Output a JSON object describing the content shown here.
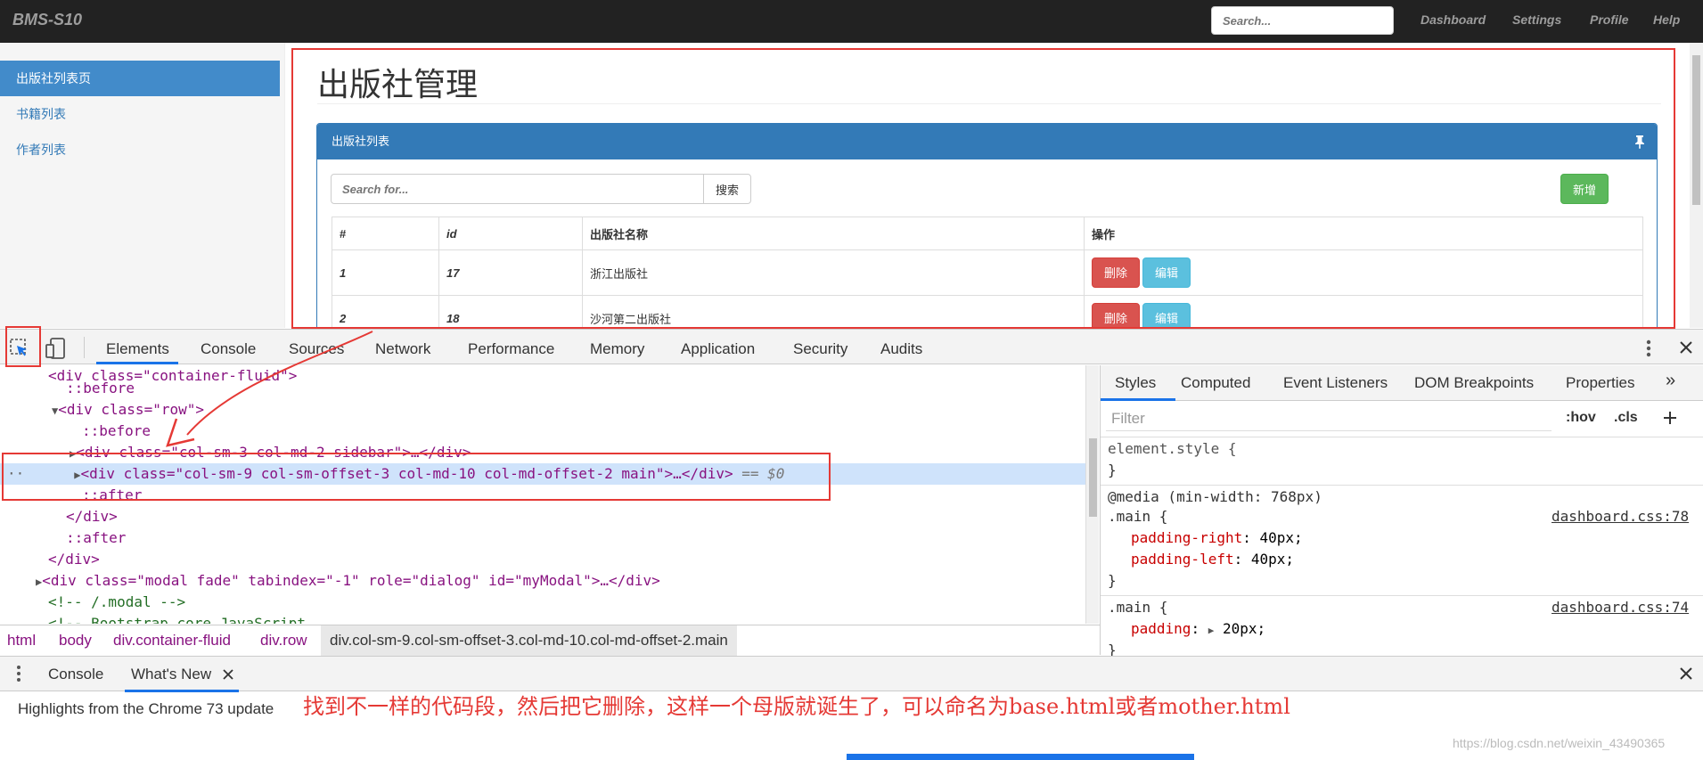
{
  "navbar": {
    "brand": "BMS-S10",
    "search_placeholder": "Search...",
    "links": [
      "Dashboard",
      "Settings",
      "Profile",
      "Help"
    ]
  },
  "sidebar": {
    "items": [
      "出版社列表页",
      "书籍列表",
      "作者列表"
    ],
    "active_index": 0
  },
  "main": {
    "title": "出版社管理",
    "panel_title": "出版社列表",
    "search_placeholder": "Search for...",
    "search_button": "搜索",
    "add_button": "新增",
    "table": {
      "headers": [
        "#",
        "id",
        "出版社名称",
        "操作"
      ],
      "rows": [
        {
          "num": "1",
          "id": "17",
          "name": "浙江出版社"
        },
        {
          "num": "2",
          "id": "18",
          "name": "沙河第二出版社"
        }
      ],
      "delete_label": "删除",
      "edit_label": "编辑"
    }
  },
  "devtools": {
    "tabs": [
      "Elements",
      "Console",
      "Sources",
      "Network",
      "Performance",
      "Memory",
      "Application",
      "Security",
      "Audits"
    ],
    "selected_tab": "Elements",
    "code": {
      "l0": "<div class=\"container-fluid\">",
      "before": "::before",
      "row_tag": "<div class=\"row\">",
      "sidebar_div": "<div class=\"col-sm-3 col-md-2 sidebar\">…</div>",
      "main_div": "<div class=\"col-sm-9 col-sm-offset-3 col-md-10 col-md-offset-2 main\">…</div>",
      "eq": "== $0",
      "after": "::after",
      "close_div": "</div>",
      "modal_div": "<div class=\"modal fade\" tabindex=\"-1\" role=\"dialog\" id=\"myModal\">…</div>",
      "comment_modal": "<!-- /.modal -->",
      "comment_bootstrap": "<!-- Bootstrap core JavaScript"
    },
    "breadcrumbs": [
      "html",
      "body",
      "div.container-fluid",
      "div.row"
    ],
    "breadcrumb_selected": "div.col-sm-9.col-sm-offset-3.col-md-10.col-md-offset-2.main",
    "styles": {
      "tabs": [
        "Styles",
        "Computed",
        "Event Listeners",
        "DOM Breakpoints",
        "Properties"
      ],
      "filter_placeholder": "Filter",
      "hov": ":hov",
      "cls": ".cls",
      "element_style": "element.style {",
      "close_brace": "}",
      "media": "@media (min-width: 768px)",
      "rule1_selector": ".main {",
      "rule1_source": "dashboard.css:78",
      "rule1_prop1": "padding-right",
      "rule1_val1": "40px;",
      "rule1_prop2": "padding-left",
      "rule1_val2": "40px;",
      "rule2_selector": ".main {",
      "rule2_source": "dashboard.css:74",
      "rule2_prop1": "padding",
      "rule2_val1": "20px;"
    },
    "drawer": {
      "tabs": [
        "Console",
        "What's New"
      ],
      "highlights": "Highlights from the Chrome 73 update"
    }
  },
  "annotation": "找到不一样的代码段，然后把它删除，这样一个母版就诞生了，可以命名为base.html或者mother.html",
  "watermark": "https://blog.csdn.net/weixin_43490365",
  "colors": {
    "navbar": "#222222",
    "primary": "#337ab7",
    "success": "#5cb85c",
    "danger": "#d9534f",
    "info": "#5bc0de",
    "annotation_red": "#e53935"
  }
}
